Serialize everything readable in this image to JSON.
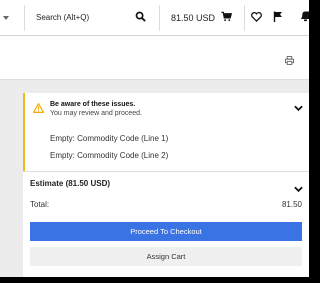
{
  "header": {
    "search_label": "Search (Alt+Q)",
    "cart_total": "81.50 USD"
  },
  "issues": {
    "title": "Be aware of these issues.",
    "subtitle": "You may review and proceed.",
    "items": [
      "Empty: Commodity Code (Line 1)",
      "Empty: Commodity Code (Line 2)"
    ],
    "accent_color": "#f2b523"
  },
  "estimate": {
    "title": "Estimate (81.50 USD)",
    "total_label": "Total:",
    "total_value": "81.50",
    "checkout_label": "Proceed To Checkout",
    "assign_label": "Assign Cart",
    "primary_color": "#3a73e3"
  },
  "icons": {
    "nav": [
      "chevron-down-icon",
      "search-icon",
      "cart-icon",
      "heart-icon",
      "flag-icon",
      "bell-icon"
    ],
    "page": [
      "print-icon",
      "warning-icon"
    ]
  }
}
